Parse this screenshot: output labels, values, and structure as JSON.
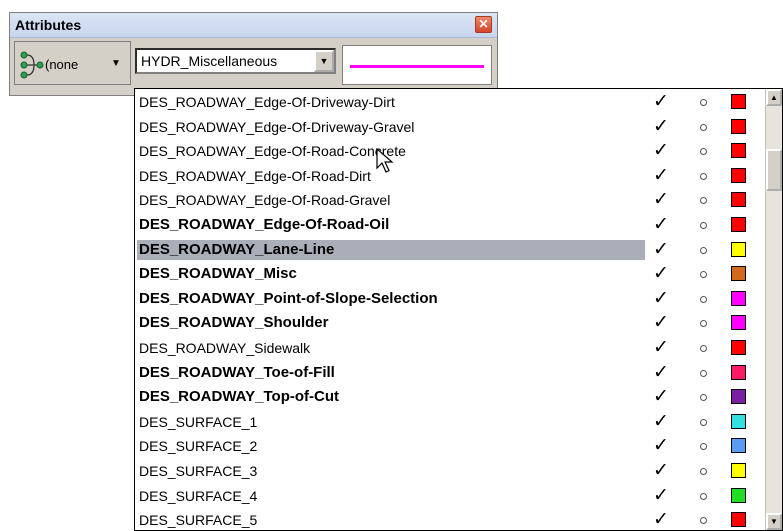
{
  "panel": {
    "title": "Attributes",
    "close_glyph": "✕",
    "level_button": {
      "label": "(none",
      "caret": "▼",
      "icon": "level-tree-icon"
    },
    "level_combo": {
      "value": "HYDR_Miscellaneous",
      "caret": "▼"
    },
    "line_style": {
      "color": "#ff00ff"
    }
  },
  "list": {
    "check_glyph": "✓",
    "rows": [
      {
        "name": "DES_ROADWAY_Edge-Of-Driveway-Dirt",
        "bold": false,
        "selected": false,
        "color": "#ff0000"
      },
      {
        "name": "DES_ROADWAY_Edge-Of-Driveway-Gravel",
        "bold": false,
        "selected": false,
        "color": "#ff0000"
      },
      {
        "name": "DES_ROADWAY_Edge-Of-Road-Concrete",
        "bold": false,
        "selected": false,
        "color": "#ff0000"
      },
      {
        "name": "DES_ROADWAY_Edge-Of-Road-Dirt",
        "bold": false,
        "selected": false,
        "color": "#ff0000"
      },
      {
        "name": "DES_ROADWAY_Edge-Of-Road-Gravel",
        "bold": false,
        "selected": false,
        "color": "#ff0000"
      },
      {
        "name": "DES_ROADWAY_Edge-Of-Road-Oil",
        "bold": true,
        "selected": false,
        "color": "#ff0000"
      },
      {
        "name": "DES_ROADWAY_Lane-Line",
        "bold": true,
        "selected": true,
        "color": "#ffff00"
      },
      {
        "name": "DES_ROADWAY_Misc",
        "bold": true,
        "selected": false,
        "color": "#d2691e"
      },
      {
        "name": "DES_ROADWAY_Point-of-Slope-Selection",
        "bold": true,
        "selected": false,
        "color": "#ff00ff"
      },
      {
        "name": "DES_ROADWAY_Shoulder",
        "bold": true,
        "selected": false,
        "color": "#ff00ff"
      },
      {
        "name": "DES_ROADWAY_Sidewalk",
        "bold": false,
        "selected": false,
        "color": "#ff0000"
      },
      {
        "name": "DES_ROADWAY_Toe-of-Fill",
        "bold": true,
        "selected": false,
        "color": "#ff1a66"
      },
      {
        "name": "DES_ROADWAY_Top-of-Cut",
        "bold": true,
        "selected": false,
        "color": "#7b1fa2"
      },
      {
        "name": "DES_SURFACE_1",
        "bold": false,
        "selected": false,
        "color": "#33e0e0"
      },
      {
        "name": "DES_SURFACE_2",
        "bold": false,
        "selected": false,
        "color": "#5b9bf0"
      },
      {
        "name": "DES_SURFACE_3",
        "bold": false,
        "selected": false,
        "color": "#ffff00"
      },
      {
        "name": "DES_SURFACE_4",
        "bold": false,
        "selected": false,
        "color": "#22dd22"
      },
      {
        "name": "DES_SURFACE_5",
        "bold": false,
        "selected": false,
        "color": "#ff0000"
      }
    ]
  },
  "scrollbar": {
    "up_glyph": "▲",
    "down_glyph": "▼"
  }
}
